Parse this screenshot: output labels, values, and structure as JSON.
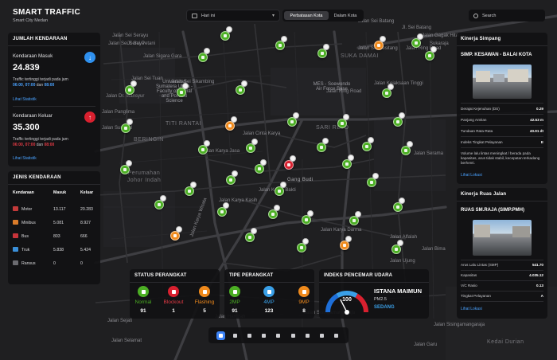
{
  "header": {
    "title": "SMART TRAFFIC",
    "subtitle": "Smart City Medan",
    "date_filter": "Hari ini",
    "tabs": [
      {
        "label": "Perbatasan Kota",
        "active": true
      },
      {
        "label": "Dalam Kota",
        "active": false
      }
    ],
    "search_placeholder": "Search"
  },
  "map": {
    "street_labels": [
      "Jalan Sei Serayu",
      "Jl. Sei Petani",
      "Jalan Sei Serayu",
      "Jalan Sei Batang",
      "Jl. Sei Batang",
      "Jalan Gagak Hitam",
      "Jalan Ring Road",
      "Sukaraja",
      "Jalan Sei Besitang",
      "Jalan Kejaksaan Tinggi",
      "Jalan Serama",
      "Jalan Sei Tuan",
      "Jalan Sigara Gara",
      "Jalan Sei Sikambing",
      "Jalan Dr. Mansyur",
      "Jalan Panglima",
      "Jalan Ring Road",
      "Jalan Cinta Karya",
      "Jalan Sunggal",
      "Jalan Karya Jasa",
      "Jalan Karya Bakti",
      "Jalan Karya Kasih",
      "Jalan Karya Darma",
      "Jalan Karya Wisata",
      "Jalan Sisingamangaraja",
      "Jalan Alfalah",
      "Jalan Ujung",
      "Jalan Bima",
      "Jalan Sejati",
      "Jalan Selamat",
      "Jalan Hamzah",
      "Jalan Sisingamangaraja",
      "Jalan Garu"
    ],
    "area_labels": [
      "SUKA DAMAI",
      "TITI RANTAI",
      "SARI REJO",
      "BERINGIN",
      "Perumahan Johor Indah",
      "Gang Budi",
      "Kedai Durian"
    ],
    "poi_labels": [
      "Universitas Sumatera Utara - Faculty of Social and Political Science",
      "MES - Soewondo Air Force Base"
    ]
  },
  "jumlah_kendaraan": {
    "title": "JUMLAH KENDARAAN",
    "masuk": {
      "label": "Kendaraan Masuk",
      "value": "24.839",
      "note_prefix": "Traffic tertinggi terjadi pada jam",
      "times": [
        "06:00",
        "07:00",
        "08:00"
      ],
      "sep1": ", ",
      "sep2": " dan ",
      "link": "Lihat Statistik"
    },
    "keluar": {
      "label": "Kendaraan Keluar",
      "value": "35.300",
      "note_prefix": "Traffic tertinggi terjadi pada jam",
      "times": [
        "06:00",
        "07:00",
        "08:00"
      ],
      "sep1": ", ",
      "sep2": " dan ",
      "link": "Lihat Statistik"
    }
  },
  "jenis_kendaraan": {
    "title": "JENIS KENDARAAN",
    "columns": [
      "Kendaraan",
      "Masuk",
      "Keluar"
    ],
    "rows": [
      {
        "icon": "motor-icon",
        "name": "Motor",
        "masuk": "13.117",
        "keluar": "20.283"
      },
      {
        "icon": "minibus-icon",
        "name": "Minibus",
        "masuk": "5.081",
        "keluar": "8.927"
      },
      {
        "icon": "bus-icon",
        "name": "Bus",
        "masuk": "803",
        "keluar": "666"
      },
      {
        "icon": "truck-icon",
        "name": "Truk",
        "masuk": "5.838",
        "keluar": "5.424"
      },
      {
        "icon": "ransus-icon",
        "name": "Ransus",
        "masuk": "0",
        "keluar": "0"
      }
    ]
  },
  "status_perangkat": {
    "title": "STATUS PERANGKAT",
    "items": [
      {
        "label": "Normal",
        "value": "91",
        "color": "#4caf24"
      },
      {
        "label": "Blockout",
        "value": "1",
        "color": "#d9202f"
      },
      {
        "label": "Flashing",
        "value": "5",
        "color": "#f08a1c"
      }
    ]
  },
  "tipe_perangkat": {
    "title": "TIPE PERANGKAT",
    "items": [
      {
        "label": "2MP",
        "value": "91",
        "color": "#4caf24"
      },
      {
        "label": "4MP",
        "value": "123",
        "color": "#3aa0e8"
      },
      {
        "label": "9MP",
        "value": "8",
        "color": "#f08a1c"
      }
    ]
  },
  "indeks_pencemar": {
    "title": "INDEKS PENCEMAR UDARA",
    "gauge_value": "100",
    "gauge_fraction": 0.35,
    "location": "ISTANA MAIMUN",
    "pollutant": "PM2.5",
    "status": "SEDANG",
    "status_color": "#3aa0e8"
  },
  "kinerja_simpang": {
    "title": "Kinerja Simpang",
    "name": "SIMP. KESAWAN - BALAI KOTA",
    "metrics": [
      {
        "label": "Derajat Kejenuhan (DS)",
        "value": "0.29"
      },
      {
        "label": "Panjang Antrian",
        "value": "42.53 m"
      },
      {
        "label": "Tundaan Rata-Rata",
        "value": "40.91 dt"
      },
      {
        "label": "Indeks Tingkat Pelayanan",
        "value": "E"
      }
    ],
    "note": "Volume lalu lintas meningkat / berada pada kapasitas, arus tidak stabil, kecepatan terkadang berhenti.",
    "link": "Lihat Lokasi"
  },
  "kinerja_ruas": {
    "title": "Kinerja Ruas Jalan",
    "name": "RUAS SM.RAJA (SIMP.PMH)",
    "metrics": [
      {
        "label": "Arus Lalu Lintas (SMP)",
        "value": "541.70"
      },
      {
        "label": "Kapasitas",
        "value": "4.035.12"
      },
      {
        "label": "V/C Rasio",
        "value": "0.13"
      },
      {
        "label": "Tingkat Pelayanan",
        "value": "A"
      }
    ],
    "link": "Lihat Lokasi"
  },
  "toolbar": {
    "items": [
      "traffic-light-icon",
      "shield-icon",
      "binoculars-icon",
      "cone-icon",
      "crossing-icon",
      "network-icon",
      "share-icon",
      "spark-icon",
      "logout-icon"
    ]
  },
  "colors": {
    "normal": "#4caf24",
    "warning": "#f08a1c",
    "alert": "#d9202f",
    "accent": "#3aa0e8"
  }
}
